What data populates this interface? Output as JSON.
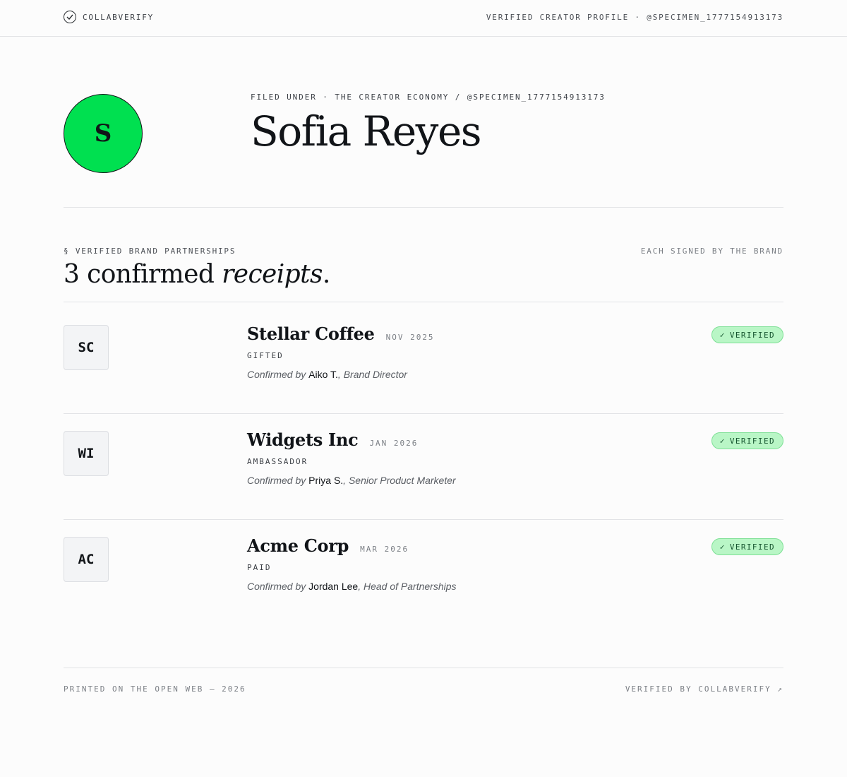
{
  "header": {
    "brand": "COLLABVERIFY",
    "brand_icon": "check-circle-icon",
    "right_text": "VERIFIED CREATOR PROFILE · @SPECIMEN_1777154913173"
  },
  "profile": {
    "avatar_initial": "S",
    "avatar_color": "#00e050",
    "eyebrow": "FILED UNDER · THE CREATOR ECONOMY / @SPECIMEN_1777154913173",
    "name": "Sofia Reyes"
  },
  "section": {
    "label": "§ VERIFIED BRAND PARTNERSHIPS",
    "right": "EACH SIGNED BY THE BRAND",
    "headline_prefix": "3 confirmed ",
    "headline_emphasis": "receipts",
    "headline_suffix": "."
  },
  "partnerships": [
    {
      "initials": "SC",
      "company": "Stellar Coffee",
      "date": "NOV 2025",
      "type": "GIFTED",
      "confirmed_prefix": "Confirmed by ",
      "confirmer": "Aiko T.",
      "role": ", Brand Director",
      "badge": "VERIFIED"
    },
    {
      "initials": "WI",
      "company": "Widgets Inc",
      "date": "JAN 2026",
      "type": "AMBASSADOR",
      "confirmed_prefix": "Confirmed by ",
      "confirmer": "Priya S.",
      "role": ", Senior Product Marketer",
      "badge": "VERIFIED"
    },
    {
      "initials": "AC",
      "company": "Acme Corp",
      "date": "MAR 2026",
      "type": "PAID",
      "confirmed_prefix": "Confirmed by ",
      "confirmer": "Jordan Lee",
      "role": ", Head of Partnerships",
      "badge": "VERIFIED"
    }
  ],
  "badge_check": "✓",
  "footer": {
    "left": "PRINTED ON THE OPEN WEB — 2026",
    "right": "VERIFIED BY COLLABVERIFY ↗"
  }
}
